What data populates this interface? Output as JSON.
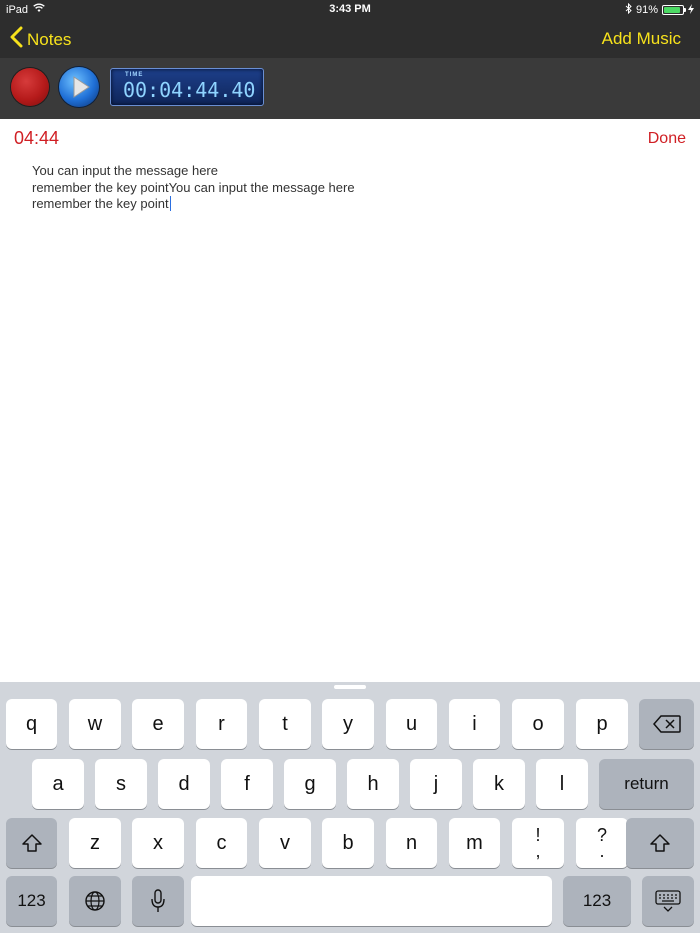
{
  "status_bar": {
    "device": "iPad",
    "time": "3:43 PM",
    "battery": "91%",
    "battery_level": 0.91
  },
  "nav": {
    "back_label": "Notes",
    "right_label": "Add Music"
  },
  "player": {
    "timer_caption": "TIME",
    "timer_value": "00:04:44.40"
  },
  "note": {
    "time_label": "04:44",
    "done_label": "Done",
    "lines": [
      "You can input the message here",
      "remember the key pointYou can input the message here",
      "remember the key point"
    ]
  },
  "keyboard": {
    "row1": [
      "q",
      "w",
      "e",
      "r",
      "t",
      "y",
      "u",
      "i",
      "o",
      "p"
    ],
    "row2": [
      "a",
      "s",
      "d",
      "f",
      "g",
      "h",
      "j",
      "k",
      "l"
    ],
    "row3": [
      "z",
      "x",
      "c",
      "v",
      "b",
      "n",
      "m"
    ],
    "row3_punct": [
      {
        "top": "!",
        "bottom": ","
      },
      {
        "top": "?",
        "bottom": "."
      }
    ],
    "return_label": "return",
    "numbers_label": "123"
  },
  "colors": {
    "accent_nav": "#f7e21c",
    "accent_red": "#d01f24",
    "bar_bg": "#2d2d2d",
    "keyboard_bg": "#d1d5db"
  },
  "icons": [
    "wifi-icon",
    "bluetooth-icon",
    "battery-icon",
    "charging-icon",
    "chevron-left-icon",
    "record-icon",
    "play-icon",
    "backspace-icon",
    "shift-icon",
    "globe-icon",
    "microphone-icon",
    "keyboard-dismiss-icon"
  ]
}
